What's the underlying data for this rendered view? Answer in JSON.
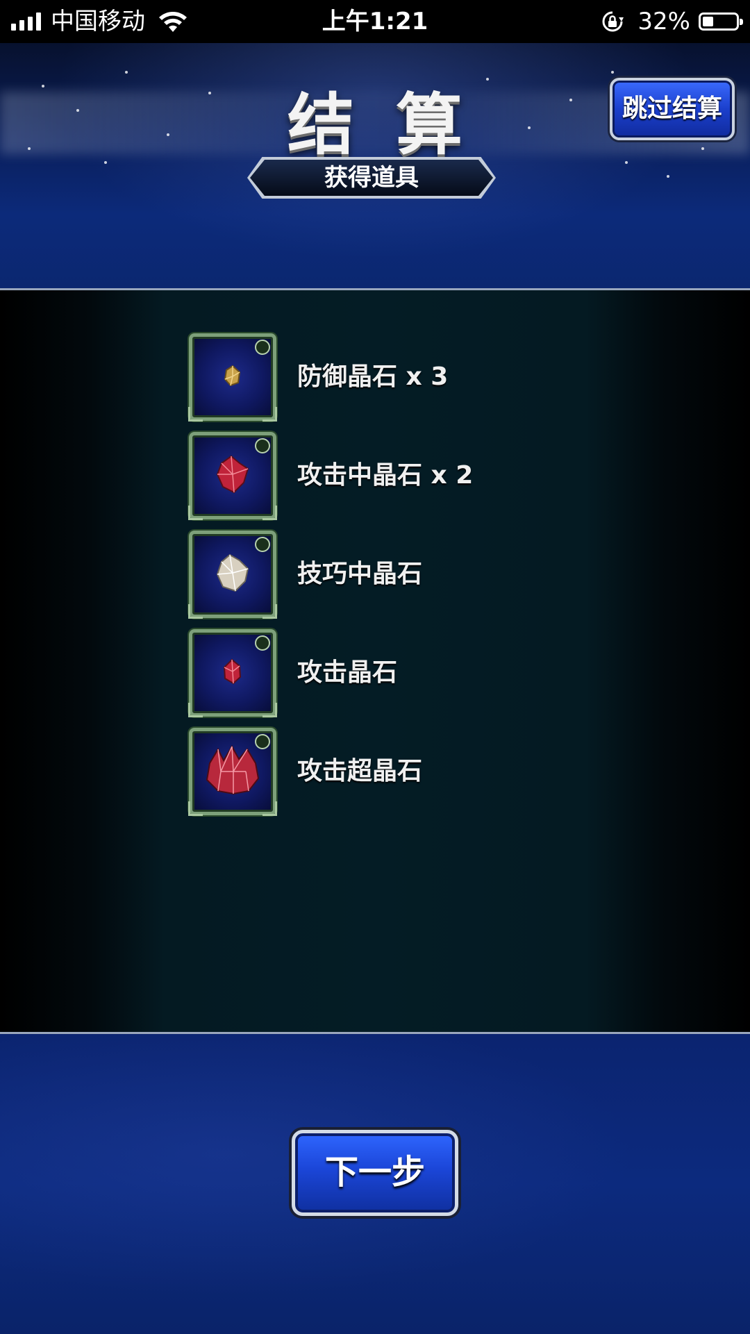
{
  "status_bar": {
    "carrier": "中国移动",
    "time": "上午1:21",
    "battery_percent": "32%",
    "battery_level": 0.32,
    "signal_bars": 4
  },
  "header": {
    "title": "结算",
    "skip_button": "跳过结算",
    "section_banner": "获得道具"
  },
  "items": [
    {
      "label": "防御晶石 x 3",
      "icon": "defense-crystal-icon",
      "color": "#c9a24a"
    },
    {
      "label": "攻击中晶石 x 2",
      "icon": "attack-medium-crystal-icon",
      "color": "#c0233a"
    },
    {
      "label": "技巧中晶石",
      "icon": "technique-medium-crystal-icon",
      "color": "#d8d0c0"
    },
    {
      "label": "攻击晶石",
      "icon": "attack-crystal-icon",
      "color": "#c0233a"
    },
    {
      "label": "攻击超晶石",
      "icon": "attack-super-crystal-icon",
      "color": "#b8283c"
    }
  ],
  "footer": {
    "next_button": "下一步"
  }
}
